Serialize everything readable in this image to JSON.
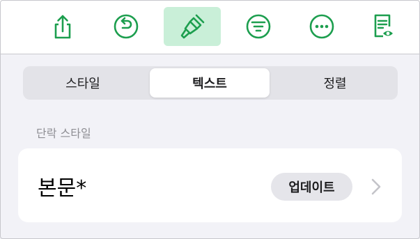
{
  "colors": {
    "accent": "#1c9e4e",
    "active_bg": "#c9efd8",
    "background": "#f2f2f7"
  },
  "toolbar": {
    "buttons": [
      {
        "icon": "share-icon"
      },
      {
        "icon": "undo-icon"
      },
      {
        "icon": "paintbrush-icon",
        "active": true
      },
      {
        "icon": "filter-list-icon"
      },
      {
        "icon": "more-icon"
      },
      {
        "icon": "document-view-icon"
      }
    ]
  },
  "tabs": [
    {
      "label": "스타일",
      "selected": false
    },
    {
      "label": "텍스트",
      "selected": true
    },
    {
      "label": "정렬",
      "selected": false
    }
  ],
  "paragraph_style": {
    "section_label": "단락 스타일",
    "current_style": "본문*",
    "update_label": "업데이트"
  }
}
